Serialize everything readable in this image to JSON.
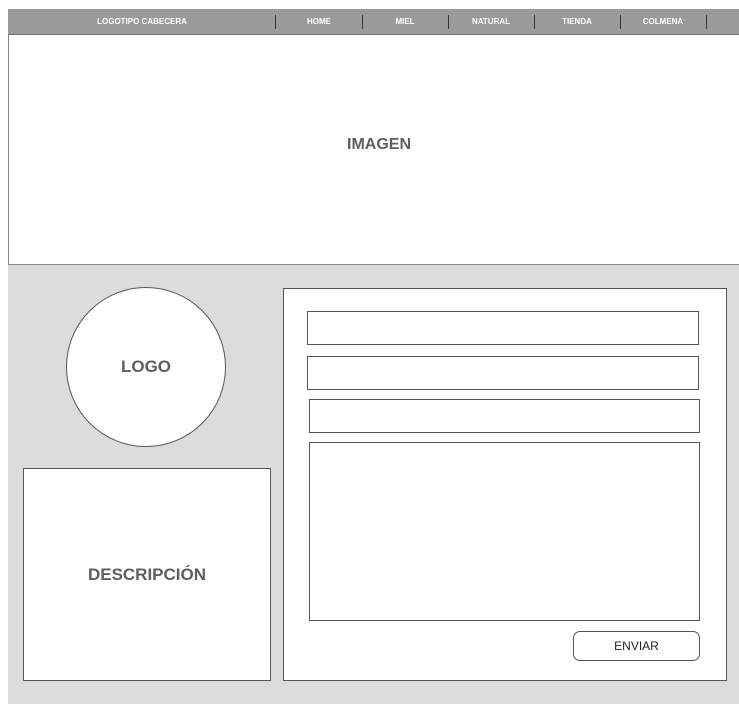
{
  "header": {
    "logo_text": "LOGOTIPO CABECERA",
    "nav": [
      "HOME",
      "MIEL",
      "NATURAL",
      "TIENDA",
      "COLMENA"
    ]
  },
  "hero": {
    "label": "IMAGEN"
  },
  "logo": {
    "label": "LOGO"
  },
  "description": {
    "label": "DESCRIPCIÓN"
  },
  "form": {
    "fields": [
      {
        "value": "",
        "placeholder": ""
      },
      {
        "value": "",
        "placeholder": ""
      },
      {
        "value": "",
        "placeholder": ""
      }
    ],
    "message": {
      "value": "",
      "placeholder": ""
    },
    "submit_label": "ENVIAR"
  },
  "colors": {
    "header_bg": "#9a9a9a",
    "section_bg": "#dcdcdc",
    "label_text": "#5e5e5e"
  }
}
